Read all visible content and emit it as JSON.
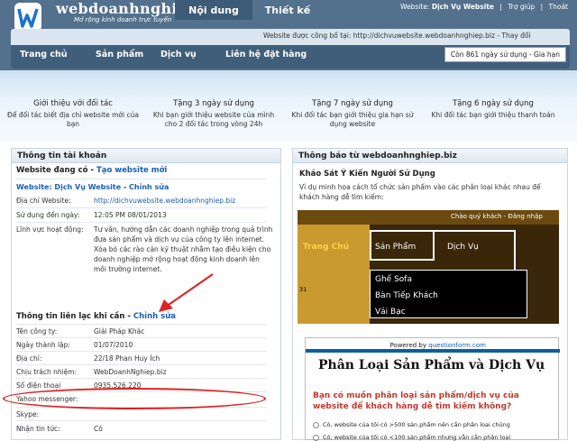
{
  "header": {
    "logo_text": "webdoanhnghiep.biz",
    "logo_sub": "Mở rộng kinh doanh trực tuyến",
    "tabs": [
      "Nội dung",
      "Thiết kế"
    ],
    "website_label": "Website:",
    "website_name": "Dịch Vụ Website",
    "support": "Trợ giúp",
    "logout": "Thoát",
    "published_note": "Website được công bố tại: http://dichvuwebsite.webdoanhnghiep.biz - Thay đổi",
    "days_left": "Còn 861 ngày sử dụng - Gia hạn"
  },
  "nav": [
    "Trang chủ",
    "Sản phẩm",
    "Dịch vụ",
    "Liên hệ đặt hàng"
  ],
  "promos": [
    {
      "title": "Giới thiệu với đối tác",
      "desc": "Để đối tác biết địa chỉ website mới của bạn"
    },
    {
      "title": "Tặng 3 ngày sử dụng",
      "desc": "Khi bạn giới thiệu website của mình cho 2 đối tác trong vòng 24h"
    },
    {
      "title": "Tặng 7 ngày sử dụng",
      "desc": "Khi đối tác bạn giới thiệu gia hạn sử dụng website"
    },
    {
      "title": "Tặng 6 ngày sử dụng",
      "desc": "Khi đối tác bạn giới thiệu thanh toán"
    }
  ],
  "account": {
    "heading": "Thông tin tài khoản",
    "website_have": "Website đang có",
    "create_new": "Tạo website mới",
    "site_line": "Website: Dịch Vụ Website",
    "edit": "Chỉnh sửa",
    "fields": [
      {
        "label": "Địa chỉ Website:",
        "value": "http://dichvuwebsite.webdoanhnghiep.biz"
      },
      {
        "label": "Sử dụng đến ngày:",
        "value": "12:05 PM 08/01/2013"
      },
      {
        "label": "Lĩnh vực hoạt động:",
        "value": "Tư vấn, hướng dẫn các doanh nghiệp trong quá trình đưa sản phẩm và dịch vụ của công ty lên internet. Xóa bỏ các rào cản kỹ thuật nhằm tạo điều kiện cho doanh nghiệp mở rộng hoạt động kinh doanh lên môi trường internet."
      }
    ],
    "contact_heading": "Thông tin liên lạc khi cần",
    "contact_edit": "Chỉnh sửa",
    "contact": [
      {
        "label": "Tên công ty:",
        "value": "Giải Pháp Khác"
      },
      {
        "label": "Ngày thành lập:",
        "value": "01/07/2010"
      },
      {
        "label": "Địa chỉ:",
        "value": "22/18 Phan Huy Ích"
      },
      {
        "label": "Chịu trách nhiệm:",
        "value": "WebDoanhNghiep.biz"
      },
      {
        "label": "Số điện thoại",
        "value": "0935.526.220"
      },
      {
        "label": "Yahoo messenger:",
        "value": ""
      },
      {
        "label": "Skype:",
        "value": ""
      },
      {
        "label": "Nhận tin tức:",
        "value": "Có"
      }
    ]
  },
  "notice": {
    "heading": "Thông báo từ webdoanhnghiep.biz",
    "survey_title": "Khảo Sát Ý Kiến Người Sử Dụng",
    "survey_desc": "Vì dụ minh họa cách tổ chức sản phẩm vào các phân loại khác nhau để khách hàng dễ tìm kiếm:",
    "img_greeting": "Chào quý khách - Đăng nhập",
    "img_menu": [
      "Trang Chủ",
      "Sản Phẩm",
      "Dịch Vụ"
    ],
    "img_sub": [
      "Ghế Sofa",
      "Bàn Tiếp Khách",
      "Vải Bạc"
    ],
    "img_corner": "31",
    "powered_by": "Powered by",
    "powered_link": "questionform.com",
    "form_title": "Phân Loại Sản Phẩm và Dịch Vụ",
    "question": "Bạn có muốn phân loại sản phẩm/dịch vụ của website để khách hàng dễ tìm kiếm không?",
    "options": [
      "Có, website của tôi có >500 sản phẩm nên cần phân loại chúng",
      "Có, website của tôi có <100 sản phẩm nhưng vẫn cần phân loại"
    ]
  },
  "colors": {
    "header": "#53708c",
    "nav": "#3f5e7a",
    "link": "#1a5fb4",
    "annotation": "#dd2222"
  }
}
